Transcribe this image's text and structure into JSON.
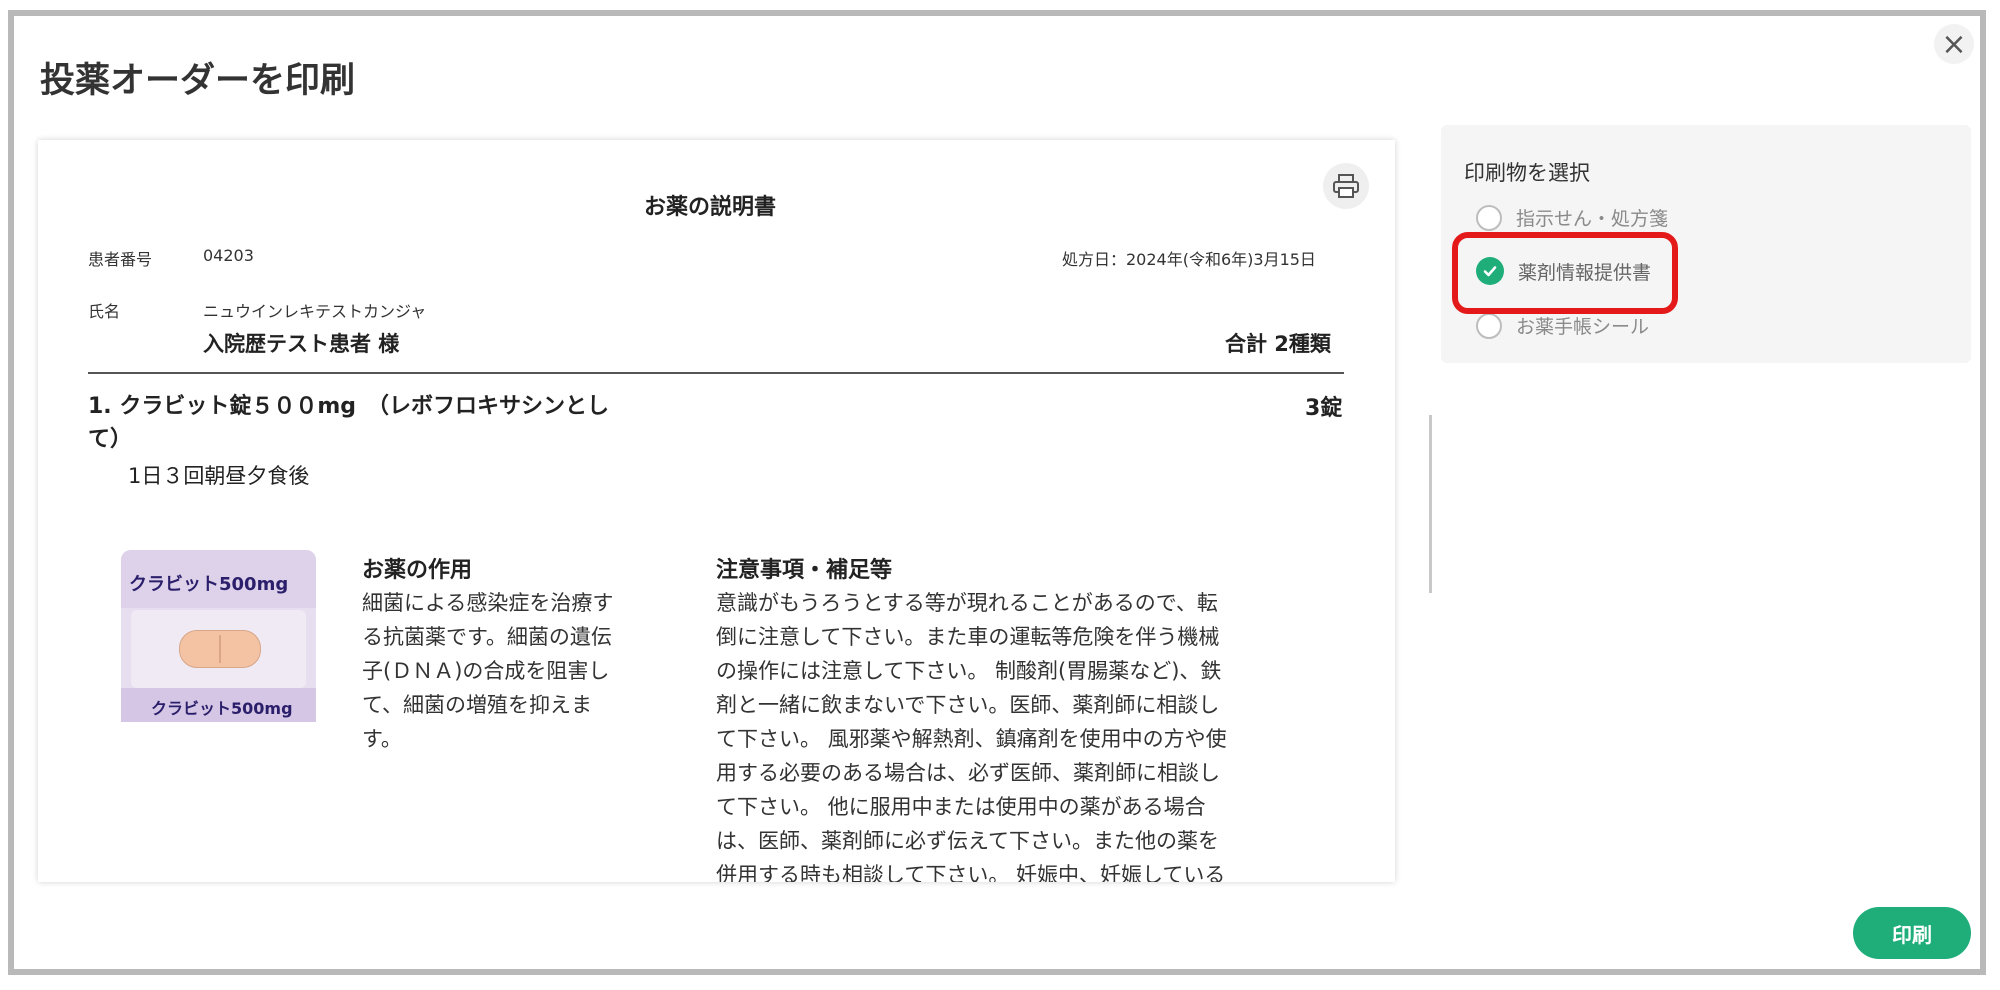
{
  "dialog": {
    "title": "投薬オーダーを印刷",
    "close_label": "×"
  },
  "document": {
    "title": "お薬の説明書",
    "patient_number_label": "患者番号",
    "patient_number": "04203",
    "prescription_date": "処方日：2024年(令和6年)3月15日",
    "name_label": "氏名",
    "patient_kana": "ニュウインレキテストカンジャ",
    "patient_name": "入院歴テスト患者 様",
    "total": "合計 2種類",
    "drug": {
      "line1": "1. クラビット錠５００mg　（レボフロキサシンとし",
      "line2": "て）",
      "quantity": "3錠",
      "dosage": "1日３回朝昼夕食後",
      "image_top_text": "クラビット500mg",
      "image_bottom_text": "クラビット500mg",
      "effect_heading": "お薬の作用",
      "effect_lines": [
        "細菌による感染症を治療す",
        "る抗菌薬です。細菌の遺伝",
        "子(ＤＮＡ)の合成を阻害し",
        "て、細菌の増殖を抑えま",
        "す。"
      ],
      "notes_heading": "注意事項・補足等",
      "notes_lines": [
        "意識がもうろうとする等が現れることがあるので、転",
        "倒に注意して下さい。また車の運転等危険を伴う機械",
        "の操作には注意して下さい。 制酸剤(胃腸薬など)、鉄",
        "剤と一緒に飲まないで下さい。医師、薬剤師に相談し",
        "て下さい。 風邪薬や解熱剤、鎮痛剤を使用中の方や使",
        "用する必要のある場合は、必ず医師、薬剤師に相談し",
        "て下さい。 他に服用中または使用中の薬がある場合",
        "は、医師、薬剤師に必ず伝えて下さい。また他の薬を",
        "併用する時も相談して下さい。 妊娠中、妊娠している"
      ]
    }
  },
  "panel": {
    "title": "印刷物を選択",
    "options": [
      {
        "label": "指示せん・処方箋",
        "selected": false
      },
      {
        "label": "薬剤情報提供書",
        "selected": true
      },
      {
        "label": "お薬手帳シール",
        "selected": false
      }
    ]
  },
  "actions": {
    "print_label": "印刷"
  },
  "colors": {
    "accent": "#1fae7a",
    "highlight": "#e41a1a"
  }
}
